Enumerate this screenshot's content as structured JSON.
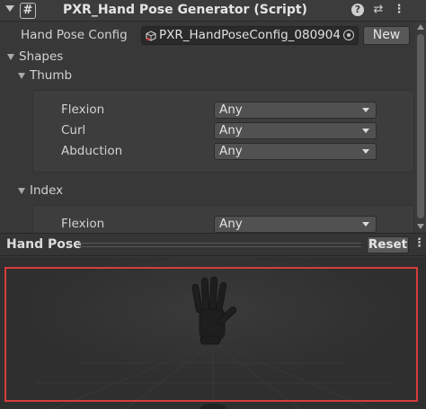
{
  "component": {
    "title": "PXR_Hand Pose Generator (Script)",
    "script_icon_glyph": "#",
    "help_glyph": "?",
    "preset_glyph": "⇄",
    "more_glyph": "⋮"
  },
  "config": {
    "label": "Hand Pose Config",
    "value": "PXR_HandPoseConfig_080904",
    "new_button": "New"
  },
  "shapes": {
    "label": "Shapes",
    "thumb": {
      "label": "Thumb",
      "rows": [
        {
          "label": "Flexion",
          "value": "Any"
        },
        {
          "label": "Curl",
          "value": "Any"
        },
        {
          "label": "Abduction",
          "value": "Any"
        }
      ]
    },
    "index": {
      "label": "Index",
      "rows": [
        {
          "label": "Flexion",
          "value": "Any"
        }
      ]
    }
  },
  "preview": {
    "title": "Hand Pose",
    "reset_button": "Reset",
    "more_glyph": "⋮"
  },
  "colors": {
    "highlight": "#d63c3c",
    "background": "#383838"
  }
}
